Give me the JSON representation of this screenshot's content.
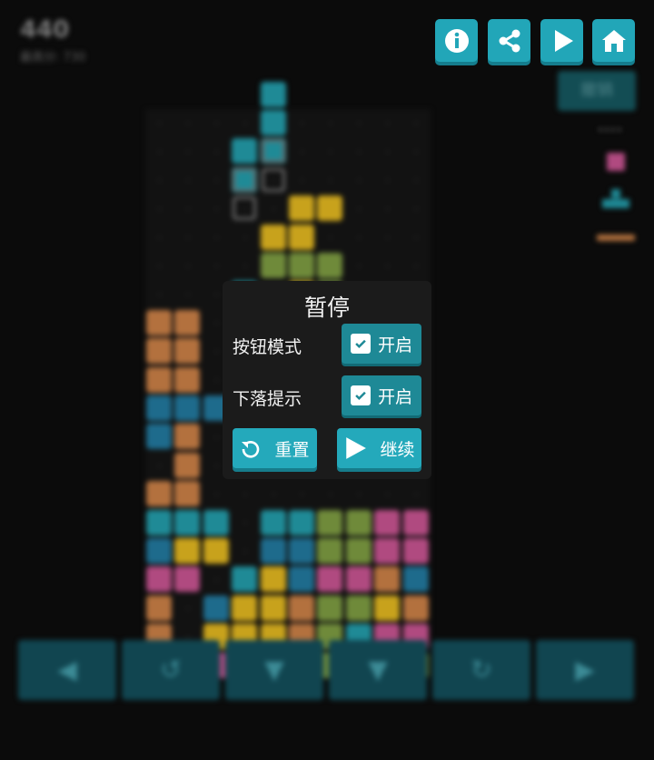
{
  "score": {
    "current": "440",
    "best_label": "最高分: 730"
  },
  "undo_label": "撤销",
  "next_dots": "••••",
  "pause_dialog": {
    "title": "暂停",
    "options": [
      {
        "label": "按钮模式",
        "state": "开启"
      },
      {
        "label": "下落提示",
        "state": "开启"
      }
    ],
    "reset_label": "重置",
    "continue_label": "继续"
  },
  "colors": {
    "accent": "#24a9bb",
    "toggle": "#1e8996",
    "dialog_bg": "#1b1b1b",
    "block_orange": "#b3713e",
    "block_blue": "#1e6b8c",
    "block_teal": "#1f8a96",
    "block_yellow": "#c8a21c",
    "block_green": "#6f8a3a",
    "block_pink": "#b04a80"
  },
  "icons": [
    "info-icon",
    "share-icon",
    "play-icon",
    "home-icon",
    "check-icon",
    "reset-icon",
    "play-icon"
  ],
  "controls": [
    "arrow-left-icon",
    "rotate-ccw-icon",
    "soft-drop-icon",
    "hard-drop-icon",
    "rotate-cw-icon",
    "arrow-right-icon"
  ]
}
